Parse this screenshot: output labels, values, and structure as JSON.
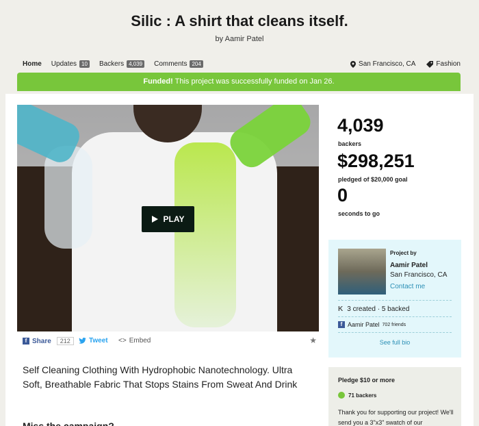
{
  "header": {
    "title": "Silic : A shirt that cleans itself.",
    "byline_prefix": "by",
    "creator": "Aamir Patel"
  },
  "nav": {
    "home": "Home",
    "updates": "Updates",
    "updates_count": "10",
    "backers": "Backers",
    "backers_count": "4,039",
    "comments": "Comments",
    "comments_count": "204",
    "location": "San Francisco, CA",
    "category": "Fashion"
  },
  "banner": {
    "bold": "Funded!",
    "text": " This project was successfully funded on Jan 26.",
    "color": "#78c63b"
  },
  "video": {
    "play_label": "PLAY"
  },
  "share": {
    "facebook": "Share",
    "facebook_count": "212",
    "twitter": "Tweet",
    "embed": "Embed"
  },
  "blurb": "Self Cleaning Clothing With Hydrophobic Nanotechnology. Ultra Soft, Breathable Fabric That Stops Stains From Sweat And Drink",
  "section_heading": "Miss the campaign?",
  "stats": {
    "backers_value": "4,039",
    "backers_label": "backers",
    "pledged_value": "$298,251",
    "pledged_label": "pledged of $20,000 goal",
    "time_value": "0",
    "time_label": "seconds to go"
  },
  "creator_box": {
    "project_by": "Project by",
    "name": "Aamir Patel",
    "location": "San Francisco, CA",
    "contact": "Contact me",
    "created": "3 created · 5 backed",
    "fb_name": "Aamir Patel",
    "fb_friends": "702 friends",
    "full_bio": "See full bio"
  },
  "reward": {
    "title": "Pledge $10 or more",
    "backers": "71 backers",
    "description": "Thank you for supporting our project! We'll send you a 3\"x3\" swatch of our"
  }
}
